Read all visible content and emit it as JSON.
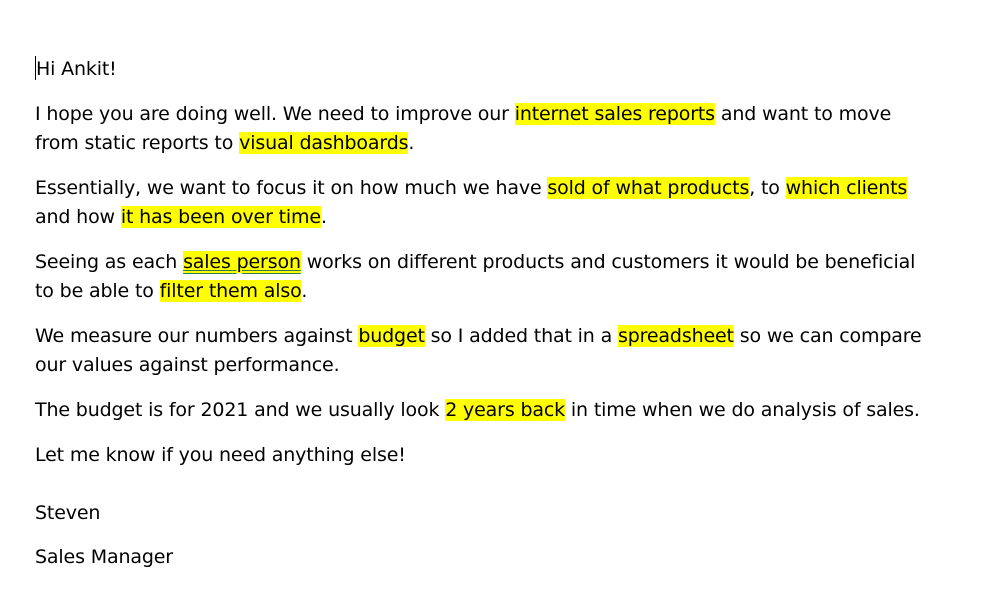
{
  "document": {
    "greeting": "Hi Ankit!",
    "p1": {
      "t1": "I hope you are doing well. We need to improve our ",
      "h1": "internet sales reports",
      "t2": " and want to move from static reports to ",
      "h2": "visual dashboards",
      "t3": "."
    },
    "p2": {
      "t1": "Essentially, we want to focus it on how much we have ",
      "h1": "sold of what products",
      "t2": ", to ",
      "h2": "which clients",
      "t3": " and how ",
      "h3": "it has been over time",
      "t4": "."
    },
    "p3": {
      "t1": "Seeing as each ",
      "h1": "sales person",
      "t2": " works on different products and customers it would be beneficial to be able to ",
      "h2": "filter them also",
      "t3": "."
    },
    "p4": {
      "t1": "We measure our numbers against ",
      "h1": "budget",
      "t2": " so I added that in a ",
      "h2": "spreadsheet",
      "t3": " so we can compare our values against performance."
    },
    "p5": {
      "t1": "The budget is for 2021 and we usually look ",
      "h1": "2 years back",
      "t2": " in time when we do analysis of sales."
    },
    "closing": "Let me know if you need anything else!",
    "signature_name": "Steven",
    "signature_title": "Sales Manager"
  },
  "colors": {
    "highlight": "#ffff00",
    "text": "#000000",
    "grammar_underline": "#2f7d4a"
  }
}
